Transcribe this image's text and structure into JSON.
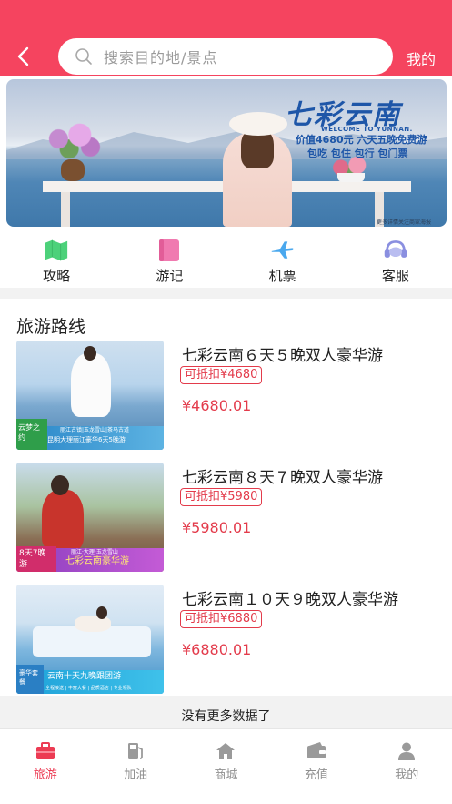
{
  "header": {
    "search_placeholder": "搜索目的地/景点",
    "mine_label": "我的"
  },
  "banner": {
    "title": "七彩云南",
    "subtitle": "WELCOME TO YUNNAN.",
    "line1": "价值4680元 六天五晚免费游",
    "line2": "包吃 包住 包行 包门票",
    "footnote": "更多详情关注商家海报"
  },
  "quick_nav": [
    {
      "label": "攻略",
      "icon": "map-icon",
      "color": "#4cd17a"
    },
    {
      "label": "游记",
      "icon": "notebook-icon",
      "color": "#f07ab0"
    },
    {
      "label": "机票",
      "icon": "airplane-icon",
      "color": "#4aa8ee"
    },
    {
      "label": "客服",
      "icon": "headset-icon",
      "color": "#8a8fe0"
    }
  ],
  "routes_section": {
    "title": "旅游路线",
    "routes": [
      {
        "title": "七彩云南６天５晚双人豪华游",
        "tag": "可抵扣¥4680",
        "price": "¥4680.01",
        "thumb_badge": "云梦之约",
        "thumb_caption": "昆明大理丽江豪华6天5晚游",
        "thumb_sub": "丽江古镇|玉龙雪山|茶马古道"
      },
      {
        "title": "七彩云南８天７晚双人豪华游",
        "tag": "可抵扣¥5980",
        "price": "¥5980.01",
        "thumb_badge": "8天7晚游",
        "thumb_caption": "七彩云南豪华游",
        "thumb_sub": "丽江·大理·玉龙雪山"
      },
      {
        "title": "七彩云南１０天９晚双人豪华游",
        "tag": "可抵扣¥6880",
        "price": "¥6880.01",
        "thumb_badge": "豪华套餐",
        "thumb_caption": "云南十天九晚跟团游",
        "thumb_sub": "全程接送 | 丰富大餐 | 品质酒店 | 专业领队"
      }
    ],
    "no_more": "没有更多数据了"
  },
  "tabbar": [
    {
      "label": "旅游",
      "icon": "suitcase-icon",
      "active": true
    },
    {
      "label": "加油",
      "icon": "fuel-pump-icon",
      "active": false
    },
    {
      "label": "商城",
      "icon": "store-icon",
      "active": false
    },
    {
      "label": "充值",
      "icon": "wallet-icon",
      "active": false
    },
    {
      "label": "我的",
      "icon": "person-icon",
      "active": false
    }
  ],
  "colors": {
    "brand": "#f5445f",
    "price": "#e33b4b",
    "tab_active": "#ec3b53",
    "tab_inactive": "#8f8f8f"
  }
}
